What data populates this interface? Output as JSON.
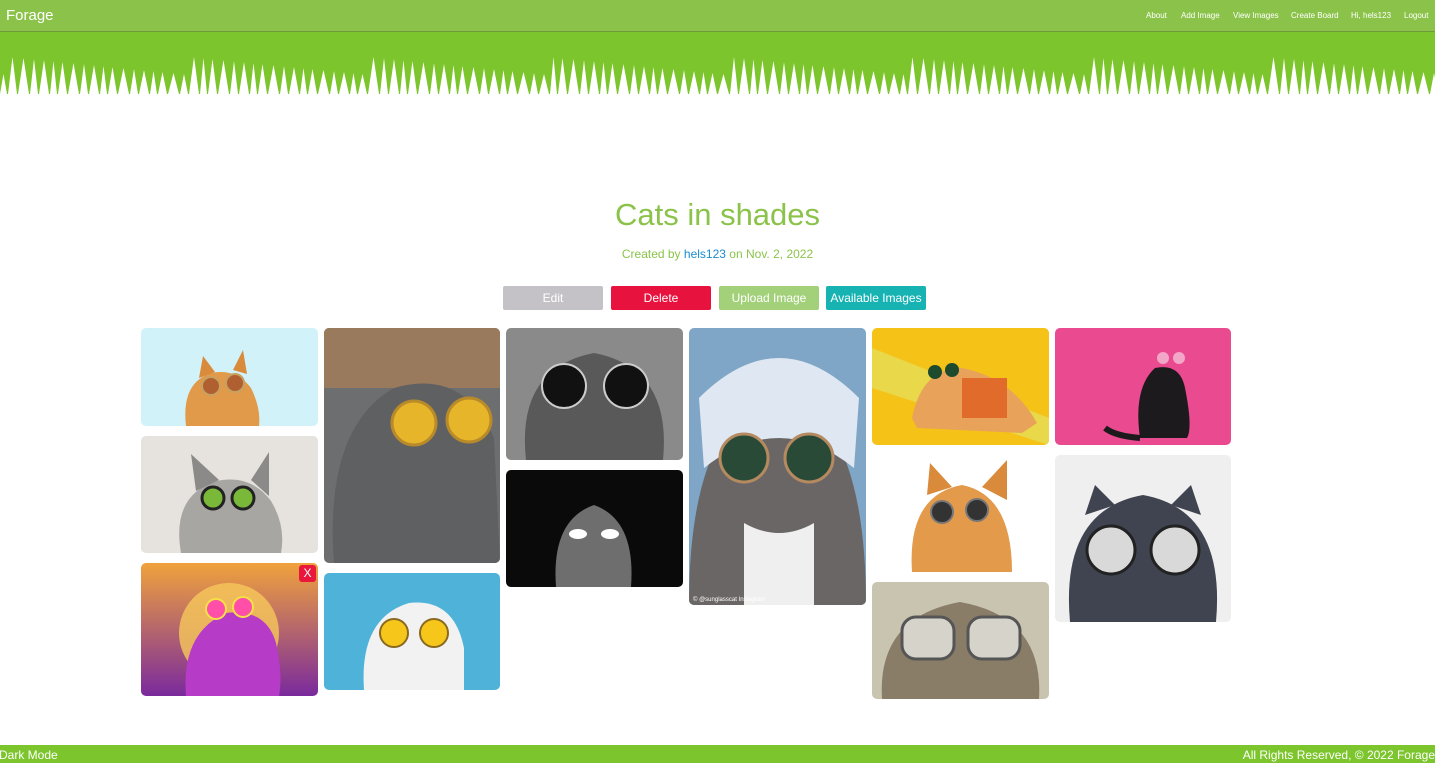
{
  "nav": {
    "brand": "Forage",
    "links": [
      "About",
      "Add Image",
      "View Images",
      "Create Board",
      "Hi, hels123",
      "Logout"
    ]
  },
  "board": {
    "title": "Cats in shades",
    "created_prefix": "Created by",
    "creator": "hels123",
    "date_text": "on Nov. 2, 2022",
    "buttons": {
      "edit": "Edit",
      "delete": "Delete",
      "upload": "Upload Image",
      "available": "Available Images"
    },
    "remove_label": "X",
    "watermark": "© @sunglasscat Instagram"
  },
  "images": [
    {
      "subject": "orange cat in round sunglasses",
      "bg": "#d2f2fa"
    },
    {
      "subject": "grey fold cat in yellow round glasses",
      "bg": "#6d6e70"
    },
    {
      "subject": "grey cat in black round sunglasses",
      "bg": "#8a8a8a"
    },
    {
      "subject": "cat with bandana and mirrored sunglasses",
      "bg": "#7fa6c6"
    },
    {
      "subject": "orange cat in hammock with sunglasses",
      "bg": "#f5c217"
    },
    {
      "subject": "black cat with heart sunglasses",
      "bg": "#ea4a8f"
    },
    {
      "subject": "fluffy grey cat in green mirror glasses",
      "bg": "#e6e2dd"
    },
    {
      "subject": "fluffy cat with glowing eyes",
      "bg": "#0a0a0a"
    },
    {
      "subject": "orange cat in round glasses",
      "bg": "#ffffff"
    },
    {
      "subject": "grey cat in large round glasses",
      "bg": "#efefef"
    },
    {
      "subject": "purple synthwave cat in pink glasses",
      "bg": "#7a2a9c"
    },
    {
      "subject": "white cat in yellow round glasses",
      "bg": "#4fb3d9"
    },
    {
      "subject": "tabby cat in large clear glasses",
      "bg": "#c9c4b0"
    }
  ],
  "colors": {
    "nav": "#8bc34a",
    "hero": "#7cc52d",
    "title": "#8bc34a",
    "link": "#1b8ccf",
    "edit": "#c4c2c7",
    "delete": "#e8123f",
    "upload": "#a3d17a",
    "available": "#17b3b3"
  },
  "footer": {
    "left": "Dark Mode",
    "right": "All Rights Reserved, © 2022 Forage"
  }
}
